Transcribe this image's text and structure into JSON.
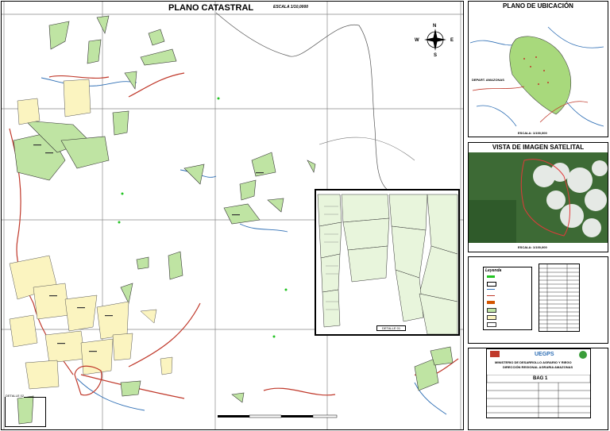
{
  "main_map": {
    "title": "PLANO CATASTRAL",
    "scale": "ESCALA 1/10,0000",
    "inset_label": "DETALLE 01",
    "sub_label": "DETALLE 02"
  },
  "location_panel": {
    "title": "PLANO DE UBICACIÓN",
    "region_label": "DEPART. AMAZONAS",
    "scale": "ESCALA: 1/100,000"
  },
  "satellite_panel": {
    "title": "VISTA DE IMAGEN SATELITAL",
    "scale": "ESCALA: 1/100,000"
  },
  "legend": {
    "title": "Leyenda"
  },
  "institution": {
    "name1": "MINISTERIO DE DESARROLLO AGRARIO Y RIEGO",
    "name2": "DIRECCIÓN REGIONAL AGRARIA AMAZONAS",
    "logo_text": "UEGPS",
    "sheet": "BAG 1"
  },
  "colors": {
    "parcel_green": "#bfe4a3",
    "parcel_yellow": "#fbf4c0",
    "road": "#c0392b",
    "river": "#2f6fb5",
    "satellite_green": "#3d6a35"
  }
}
